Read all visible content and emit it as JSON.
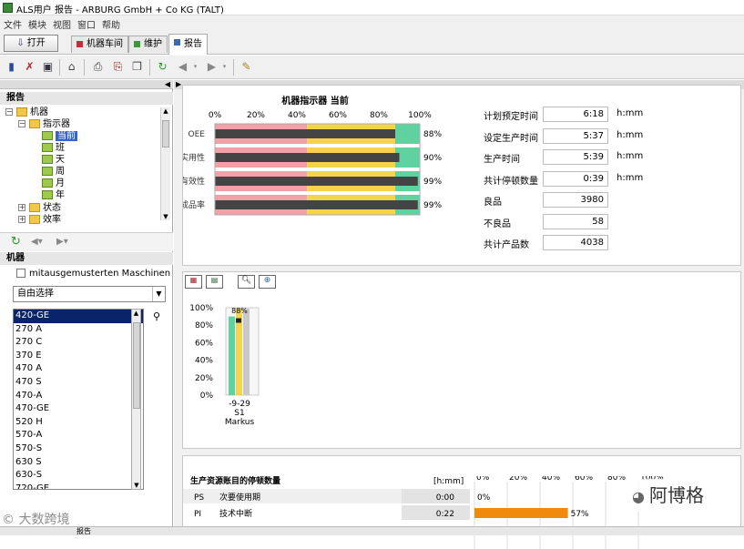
{
  "window": {
    "title": "ALS用户 报告 - ARBURG GmbH + Co KG (TALT)"
  },
  "menu": [
    "文件",
    "模块",
    "视图",
    "窗口",
    "帮助"
  ],
  "open_button": "打开",
  "tabs": [
    {
      "label": "机器车间",
      "color": "#c0303a"
    },
    {
      "label": "维护",
      "color": "#3a9a3a"
    },
    {
      "label": "报告",
      "color": "#3a6ab0"
    }
  ],
  "report_section": {
    "title": "报告",
    "tree": {
      "root": "机器",
      "indicator": "指示器",
      "items": [
        "当前",
        "班",
        "天",
        "周",
        "月",
        "年"
      ],
      "status": "状态",
      "efficiency": "效率"
    }
  },
  "machines_section": {
    "title": "机器",
    "checkbox_label": "mitausgemusterten Maschinen",
    "dropdown_value": "自由选择",
    "list": [
      "420-GE",
      "270 A",
      "270 C",
      "370 E",
      "470 A",
      "470 S",
      "470-A",
      "470-GE",
      "520 H",
      "570-A",
      "570-S",
      "630 S",
      "630-S",
      "720-GE"
    ],
    "selected": "420-GE"
  },
  "indicator_panel": {
    "title": "机器指示器 当前",
    "rows": [
      {
        "label": "计划预定时间",
        "value": "6:18",
        "unit": "h:mm"
      },
      {
        "label": "设定生产时间",
        "value": "5:37",
        "unit": "h:mm"
      },
      {
        "label": "生产时间",
        "value": "5:39",
        "unit": "h:mm"
      },
      {
        "label": "共计停顿数量",
        "value": "0:39",
        "unit": "h:mm"
      },
      {
        "label": "良品",
        "value": "3980",
        "unit": ""
      },
      {
        "label": "不良品",
        "value": "58",
        "unit": ""
      },
      {
        "label": "共计产品数",
        "value": "4038",
        "unit": ""
      }
    ]
  },
  "chart_data": [
    {
      "type": "bar",
      "title": "机器指示器 当前",
      "orientation": "horizontal",
      "categories": [
        "OEE",
        "实用性",
        "有效性",
        "成品率"
      ],
      "values": [
        88,
        90,
        99,
        99
      ],
      "value_labels": [
        "88%",
        "90%",
        "99%",
        "99%"
      ],
      "xlim": [
        0,
        100
      ],
      "x_ticks": [
        "0%",
        "20%",
        "40%",
        "60%",
        "80%",
        "100%"
      ],
      "zones": [
        {
          "to": 45,
          "color": "#f4a0a8"
        },
        {
          "to": 88,
          "color": "#f5d34a"
        },
        {
          "to": 100,
          "color": "#5ed3a0"
        }
      ]
    },
    {
      "type": "bar",
      "categories": [
        "-9-29 S1 Markus"
      ],
      "x_label_lines": [
        "-9-29",
        "S1",
        "Markus"
      ],
      "series": [
        {
          "name": "实用性",
          "values": [
            90
          ],
          "color": "#5ed3a0"
        },
        {
          "name": "有效性",
          "values": [
            99
          ],
          "color": "#f5d34a"
        },
        {
          "name": "成品率",
          "values": [
            99
          ],
          "color": "#c8c8c8"
        },
        {
          "name": "OEE",
          "values": [
            88
          ],
          "color": "#222222"
        }
      ],
      "data_label": "88%",
      "ylim": [
        0,
        100
      ],
      "y_ticks": [
        "100%",
        "80%",
        "60%",
        "40%",
        "20%",
        "0%"
      ]
    },
    {
      "type": "bar",
      "title": "生产资源账目的停顿数量",
      "unit_header": "[h:mm]",
      "rows": [
        {
          "code": "PS",
          "label": "次要使用期",
          "time": "0:00",
          "value": 0,
          "pct_label": "0%"
        },
        {
          "code": "PI",
          "label": "技术中断",
          "time": "0:22",
          "value": 57,
          "pct_label": "57%"
        }
      ],
      "x_ticks": [
        "0%",
        "20%",
        "40%",
        "60%",
        "80%",
        "100%"
      ]
    }
  ],
  "watermark": {
    "text": "阿博格",
    "left_text": "© 大数跨境"
  },
  "status": {
    "text": "报告"
  }
}
